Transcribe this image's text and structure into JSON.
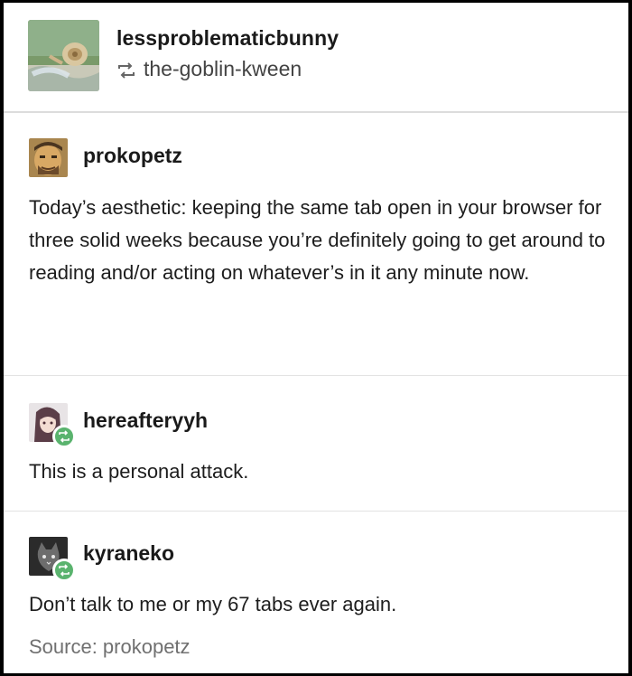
{
  "header": {
    "username": "lessproblematicbunny",
    "reblogged_from": "the-goblin-kween",
    "avatar_icon": "snail-avatar",
    "reblog_icon": "reblog-icon"
  },
  "posts": [
    {
      "username": "prokopetz",
      "avatar_icon": "cartoon-man-avatar",
      "text": "Today’s aesthetic: keeping the same tab open in your browser for three solid weeks because you’re definitely going to get around to reading and/or acting on whatever’s in it any minute now."
    },
    {
      "username": "hereafteryyh",
      "avatar_icon": "anime-girl-avatar",
      "badge_icon": "reblog-badge-icon",
      "text": "This is a personal attack."
    },
    {
      "username": "kyraneko",
      "avatar_icon": "cat-avatar",
      "badge_icon": "reblog-badge-icon",
      "text": "Don’t talk to me or my 67 tabs ever again."
    }
  ],
  "source": "Source: prokopetz",
  "colors": {
    "background": "#ffffff",
    "frame": "#000000",
    "badge": "#5ab36e",
    "muted_text": "#707070"
  }
}
